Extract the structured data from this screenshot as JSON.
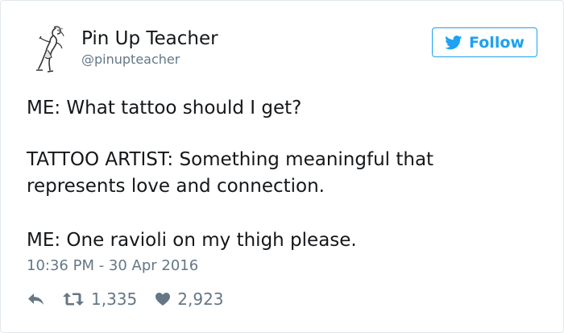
{
  "user": {
    "display_name": "Pin Up Teacher",
    "handle": "@pinupteacher"
  },
  "follow_button": {
    "label": "Follow"
  },
  "tweet": {
    "lines": [
      "ME: What tattoo should I get?",
      "TATTOO ARTIST: Something meaningful that",
      "represents love and connection.",
      "ME: One ravioli on my thigh please."
    ],
    "timestamp": "10:36 PM - 30 Apr 2016"
  },
  "actions": {
    "retweets": "1,335",
    "likes": "2,923"
  },
  "icons": {
    "avatar": "pinup-figure-avatar",
    "follow": "bird-icon",
    "reply": "reply-icon",
    "retweet": "retweet-icon",
    "like": "heart-icon"
  },
  "colors": {
    "accent": "#1da1f2",
    "text": "#14171a",
    "muted": "#657786",
    "border": "#e1e8ed"
  }
}
